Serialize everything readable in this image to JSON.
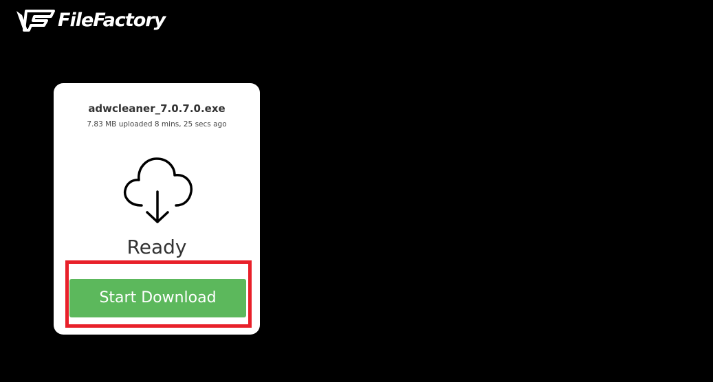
{
  "header": {
    "logo_text": "FileFactory",
    "logo_icon": "filefactory-logo-icon"
  },
  "card": {
    "file_name": "adwcleaner_7.0.7.0.exe",
    "file_meta": "7.83 MB uploaded 8 mins, 25 secs ago",
    "icon": "cloud-download-icon",
    "status": "Ready",
    "button_label": "Start Download"
  },
  "colors": {
    "background": "#000000",
    "card": "#ffffff",
    "button": "#5cb85c",
    "highlight": "#e8202a"
  }
}
